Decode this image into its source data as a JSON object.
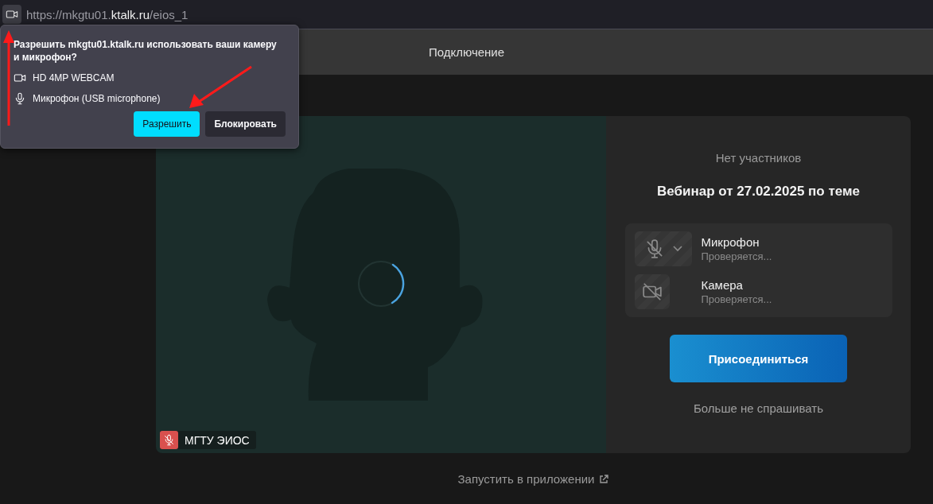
{
  "address_bar": {
    "url_parts": [
      {
        "text": "https://mkgtu01.",
        "kind": "dim"
      },
      {
        "text": "ktalk.ru",
        "kind": "host"
      },
      {
        "text": "/eios_1",
        "kind": "dim"
      }
    ]
  },
  "permission_popup": {
    "question": "Разрешить mkgtu01.ktalk.ru использовать ваши камеру и микрофон?",
    "devices": [
      {
        "kind": "camera",
        "label": "HD 4MP WEBCAM"
      },
      {
        "kind": "mic",
        "label": "Микрофон (USB microphone)"
      }
    ],
    "buttons": [
      {
        "label": "Разрешить",
        "kind": "primary"
      },
      {
        "label": "Блокировать",
        "kind": "secondary"
      }
    ]
  },
  "header": {
    "title": "Подключение"
  },
  "preview": {
    "name": "МГТУ ЭИОС",
    "muted": true
  },
  "panel": {
    "participants": "Нет участников",
    "meeting_title": "Вебинар от 27.02.2025 по теме",
    "devices": [
      {
        "kind": "mic",
        "name": "Микрофон",
        "status": "Проверяется...",
        "on": false
      },
      {
        "kind": "camera",
        "name": "Камера",
        "status": "Проверяется...",
        "on": false
      }
    ],
    "join_button": "Присоединиться",
    "dont_ask": "Больше не спрашивать"
  },
  "launch_app": "Запустить в приложении"
}
